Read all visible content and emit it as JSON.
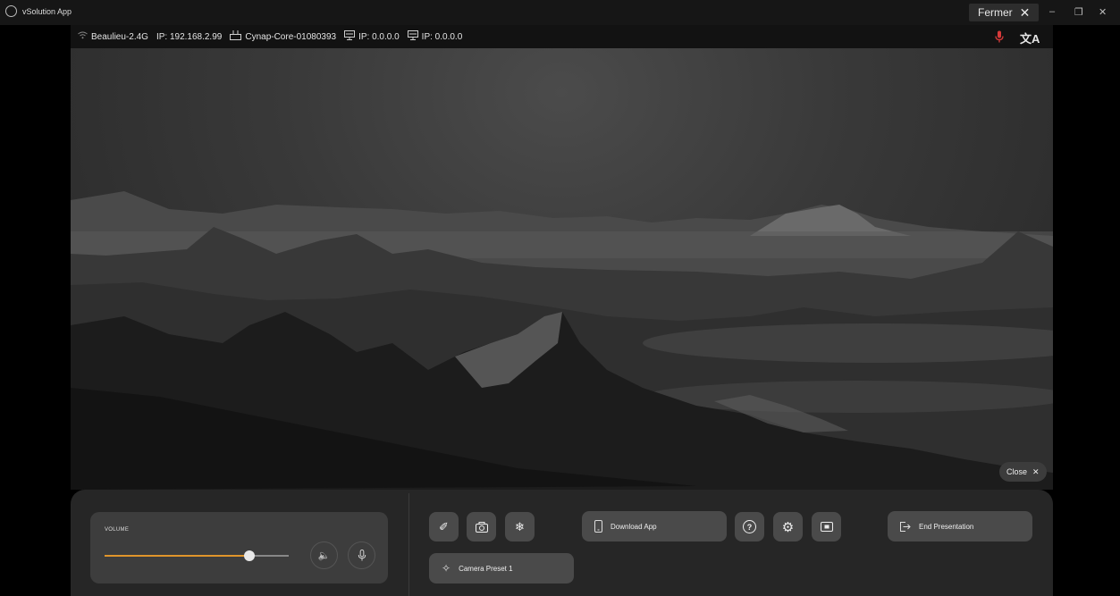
{
  "window": {
    "title": "vSolution App",
    "close_label": "Fermer",
    "close_glyph": "✕",
    "minimize_glyph": "–",
    "restore_glyph": "❐",
    "window_close_glyph": "✕"
  },
  "status": {
    "wifi_name": "Beaulieu-2.4G",
    "wifi_ip": "IP: 192.168.2.99",
    "device_name": "Cynap-Core-01080393",
    "lan1_ip": "IP: 0.0.0.0",
    "lan2_ip": "IP: 0.0.0.0",
    "translate_glyph": "文A",
    "mic_color": "#d83a3a"
  },
  "presentation": {
    "close_label": "Close",
    "close_glyph": "✕"
  },
  "controls": {
    "volume_label": "VOLUME",
    "volume_level_fraction": 0.79,
    "speaker_glyph": "🔈",
    "mic_glyph": "🎙",
    "annotate_glyph": "✐",
    "camera_glyph": "📷",
    "freeze_glyph": "❄",
    "download_label": "Download App",
    "download_glyph": "▯",
    "help_glyph": "?",
    "settings_glyph": "⚙",
    "screen_glyph": "▣",
    "end_label": "End Presentation",
    "end_glyph": "⇥",
    "camera_preset_label": "Camera Preset 1",
    "camera_preset_glyph": "✧",
    "accent_color": "#e0952b"
  }
}
